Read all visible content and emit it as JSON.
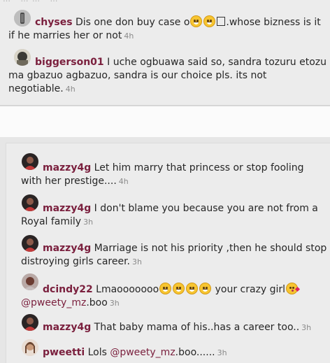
{
  "top_fragment": "… · … … · …",
  "comments_top": [
    {
      "user": "chyses",
      "text": " Dis one don buy case o",
      "emoji": [
        "grinning-sweat-emoji",
        "grin-emoji"
      ],
      "after_emoji": ".whose bizness is it if he marries her or not",
      "time": "4h"
    },
    {
      "user": "biggerson01",
      "text": " I uche ogbuawa said so, sandra tozuru etozu ma gbazuo agbazuo, sandra is our choice pls. its not negotiable.",
      "time": "4h"
    }
  ],
  "comments_bottom": [
    {
      "user": "mazzy4g",
      "text": " Let him marry that princess or stop fooling with her prestige....",
      "time": "4h"
    },
    {
      "user": "mazzy4g",
      "text": " I don't blame you because you are not from a Royal family",
      "time": "3h"
    },
    {
      "user": "mazzy4g",
      "text": " Marriage is not his priority ,then he should stop distroying girls career.",
      "time": "3h"
    },
    {
      "user": "dcindy22",
      "text": " Lmaooooooo",
      "emoji_count": 4,
      "mid": " your crazy girl",
      "mention": "@pweety_mz",
      "tail": ".boo",
      "time": "3h"
    },
    {
      "user": "mazzy4g",
      "text": " That baby mama of his..has a career too..",
      "time": "3h"
    },
    {
      "user": "pweetti",
      "text": " Lols ",
      "mention": "@pweety_mz",
      "tail": ".boo......",
      "time": "3h"
    }
  ],
  "colors": {
    "username": "#7a1f3d",
    "timestamp": "#8a8a8a",
    "text": "#262626",
    "background": "#ececec"
  }
}
